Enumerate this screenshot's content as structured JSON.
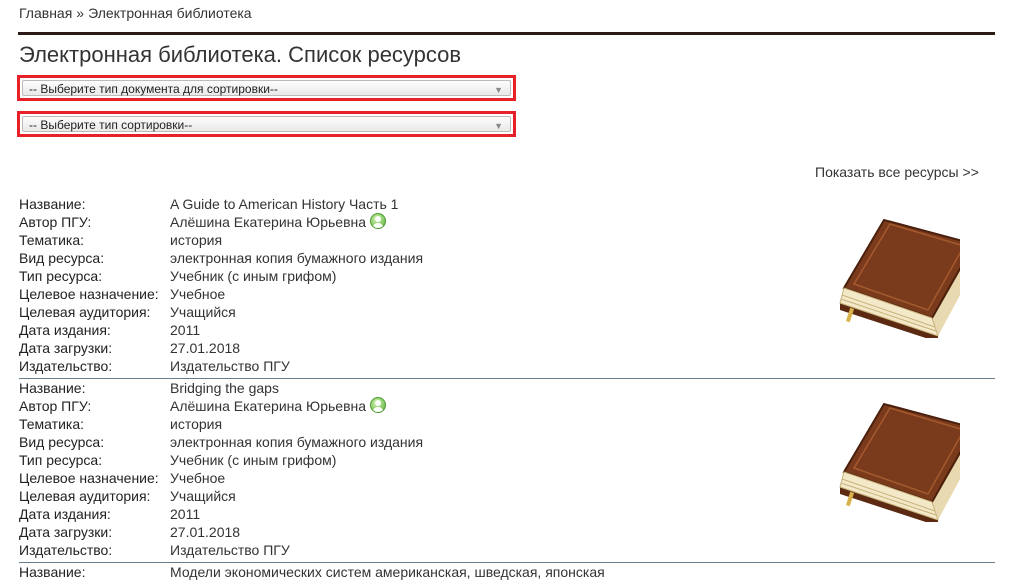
{
  "breadcrumb": {
    "home": "Главная",
    "separator": "»",
    "current": "Электронная библиотека"
  },
  "page_title": "Электронная библиотека. Список ресурсов",
  "filters": {
    "doc_type_select": "-- Выберите тип документа для сортировки--",
    "sort_type_select": "-- Выберите тип сортировки--"
  },
  "show_all_link": "Показать все ресурсы >>",
  "labels": {
    "title": "Название:",
    "author": "Автор ПГУ:",
    "subject": "Тематика:",
    "resource_kind": "Вид ресурса:",
    "resource_type": "Тип ресурса:",
    "purpose": "Целевое назначение:",
    "audience": "Целевая аудитория:",
    "pub_date": "Дата издания:",
    "upload_date": "Дата загрузки:",
    "publisher": "Издательство:"
  },
  "records": [
    {
      "title": "A Guide to American History Часть 1",
      "author": "Алёшина Екатерина Юрьевна",
      "subject": "история",
      "resource_kind": "электронная копия бумажного издания",
      "resource_type": "Учебник (с иным грифом)",
      "purpose": "Учебное",
      "audience": "Учащийся",
      "pub_date": "2011",
      "upload_date": "27.01.2018",
      "publisher": "Издательство ПГУ"
    },
    {
      "title": "Bridging the gaps",
      "author": "Алёшина Екатерина Юрьевна",
      "subject": "история",
      "resource_kind": "электронная копия бумажного издания",
      "resource_type": "Учебник (с иным грифом)",
      "purpose": "Учебное",
      "audience": "Учащийся",
      "pub_date": "2011",
      "upload_date": "27.01.2018",
      "publisher": "Издательство ПГУ"
    },
    {
      "title": "Модели экономических систем американская, шведская, японская"
    }
  ],
  "colors": {
    "highlight_border": "#e8202a",
    "rule": "#2b1a16",
    "book_cover": "#7a3a1c"
  },
  "icons": [
    "avatar-icon",
    "book-icon",
    "dropdown-arrow-icon"
  ]
}
